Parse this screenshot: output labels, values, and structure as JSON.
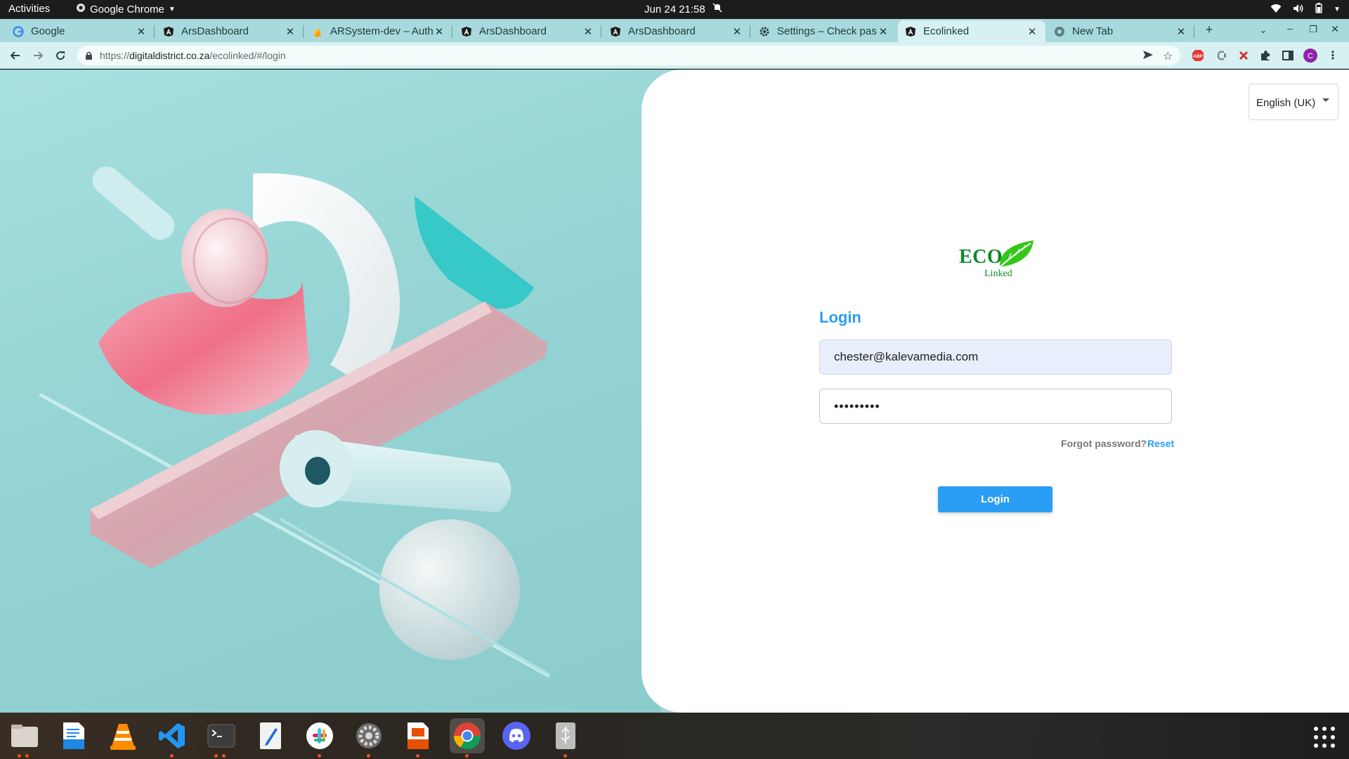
{
  "topbar": {
    "activities": "Activities",
    "app_name": "Google Chrome",
    "clock": "Jun 24  21:58"
  },
  "tabs": [
    {
      "title": "Google",
      "icon": "google-icon"
    },
    {
      "title": "ArsDashboard",
      "icon": "angular-icon"
    },
    {
      "title": "ARSystem-dev – Auth",
      "icon": "firebase-icon"
    },
    {
      "title": "ArsDashboard",
      "icon": "angular-icon"
    },
    {
      "title": "ArsDashboard",
      "icon": "angular-icon"
    },
    {
      "title": "Settings – Check pass",
      "icon": "gear-icon"
    },
    {
      "title": "Ecolinked",
      "icon": "angular-icon",
      "active": true
    },
    {
      "title": "New Tab",
      "icon": "chrome-icon"
    }
  ],
  "omnibox": {
    "url_prefix": "https://",
    "url_host": "digitaldistrict.co.za",
    "url_path": "/ecolinked/#/login"
  },
  "extensions": {
    "abp": "ABP",
    "profile_initial": "C"
  },
  "page": {
    "language": "English (UK)",
    "logo_word": "ECO",
    "logo_sub": "Linked",
    "login_title": "Login",
    "email_value": "chester@kalevamedia.com",
    "password_value": "•••••••••",
    "forgot_label": "Forgot password?",
    "reset_label": "Reset",
    "login_button": "Login"
  },
  "dock": [
    "files-icon",
    "writer-icon",
    "vlc-icon",
    "vscode-icon",
    "terminal-icon",
    "text-editor-icon",
    "slack-icon",
    "settings-icon",
    "impress-icon",
    "chrome-icon",
    "discord-icon",
    "usb-creator-icon"
  ],
  "colors": {
    "accent": "#2a9df4",
    "brand_green": "#0e8a25",
    "tab_strip": "#a8d9dc",
    "toolbar": "#d7f1f2"
  }
}
